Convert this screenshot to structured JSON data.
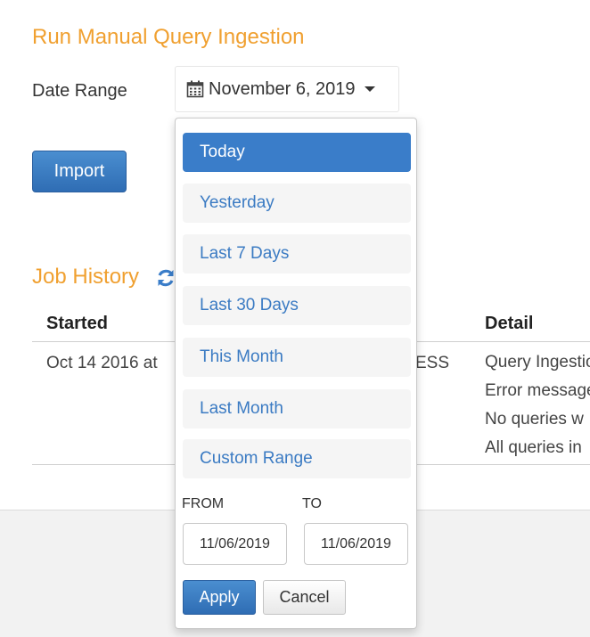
{
  "ingestion": {
    "title": "Run Manual Query Ingestion",
    "date_range_label": "Date Range",
    "selected_date": "November 6, 2019",
    "import_label": "Import"
  },
  "history": {
    "title": "Job History",
    "columns": {
      "started": "Started",
      "detail": "Detail"
    },
    "row": {
      "started": "Oct 14 2016 at",
      "status": "ESS",
      "detail_lines": [
        "Query Ingestion",
        "Error message",
        "No queries w",
        "All queries in"
      ]
    }
  },
  "date_picker": {
    "ranges": [
      "Today",
      "Yesterday",
      "Last 7 Days",
      "Last 30 Days",
      "This Month",
      "Last Month",
      "Custom Range"
    ],
    "active_range": "Today",
    "from_label": "FROM",
    "to_label": "TO",
    "from_value": "11/06/2019",
    "to_value": "11/06/2019",
    "apply_label": "Apply",
    "cancel_label": "Cancel"
  },
  "icons": {
    "calendar": "calendar-icon",
    "caret": "caret-down-icon",
    "refresh": "refresh-icon"
  },
  "colors": {
    "title_orange": "#f0a030",
    "primary_blue": "#3a7dc9",
    "link_blue": "#3b7bc3"
  }
}
